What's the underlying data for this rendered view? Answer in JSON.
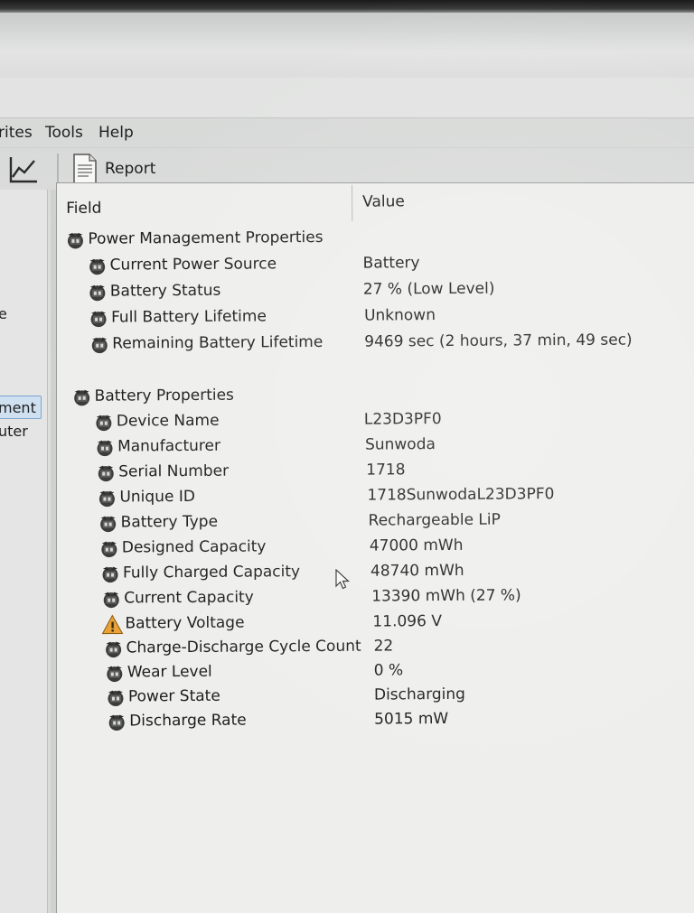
{
  "menu": {
    "items": [
      "rites",
      "Tools",
      "Help"
    ]
  },
  "toolbar": {
    "report_label": "Report"
  },
  "left_panel": {
    "items": [
      "e",
      "ment",
      "uter"
    ]
  },
  "columns": {
    "field": "Field",
    "value": "Value"
  },
  "groups": [
    {
      "title": "Power Management Properties",
      "rows": [
        {
          "field": "Current Power Source",
          "value": "Battery",
          "icon": "battery-icon"
        },
        {
          "field": "Battery Status",
          "value": "27 % (Low Level)",
          "icon": "battery-icon"
        },
        {
          "field": "Full Battery Lifetime",
          "value": "Unknown",
          "icon": "battery-icon"
        },
        {
          "field": "Remaining Battery Lifetime",
          "value": "9469 sec (2 hours, 37 min, 49 sec)",
          "icon": "battery-icon"
        }
      ]
    },
    {
      "title": "Battery Properties",
      "rows": [
        {
          "field": "Device Name",
          "value": "L23D3PF0",
          "icon": "battery-icon"
        },
        {
          "field": "Manufacturer",
          "value": "Sunwoda",
          "icon": "battery-icon"
        },
        {
          "field": "Serial Number",
          "value": "1718",
          "icon": "battery-icon"
        },
        {
          "field": "Unique ID",
          "value": "1718SunwodaL23D3PF0",
          "icon": "battery-icon"
        },
        {
          "field": "Battery Type",
          "value": "Rechargeable LiP",
          "icon": "battery-icon"
        },
        {
          "field": "Designed Capacity",
          "value": "47000 mWh",
          "icon": "battery-icon"
        },
        {
          "field": "Fully Charged Capacity",
          "value": "48740 mWh",
          "icon": "battery-icon"
        },
        {
          "field": "Current Capacity",
          "value": "13390 mWh  (27 %)",
          "icon": "battery-icon"
        },
        {
          "field": "Battery Voltage",
          "value": "11.096 V",
          "icon": "warning-icon"
        },
        {
          "field": "Charge-Discharge Cycle Count",
          "value": "22",
          "icon": "battery-icon"
        },
        {
          "field": "Wear Level",
          "value": "0 %",
          "icon": "battery-icon"
        },
        {
          "field": "Power State",
          "value": "Discharging",
          "icon": "battery-icon"
        },
        {
          "field": "Discharge Rate",
          "value": "5015 mW",
          "icon": "battery-icon"
        }
      ]
    }
  ]
}
